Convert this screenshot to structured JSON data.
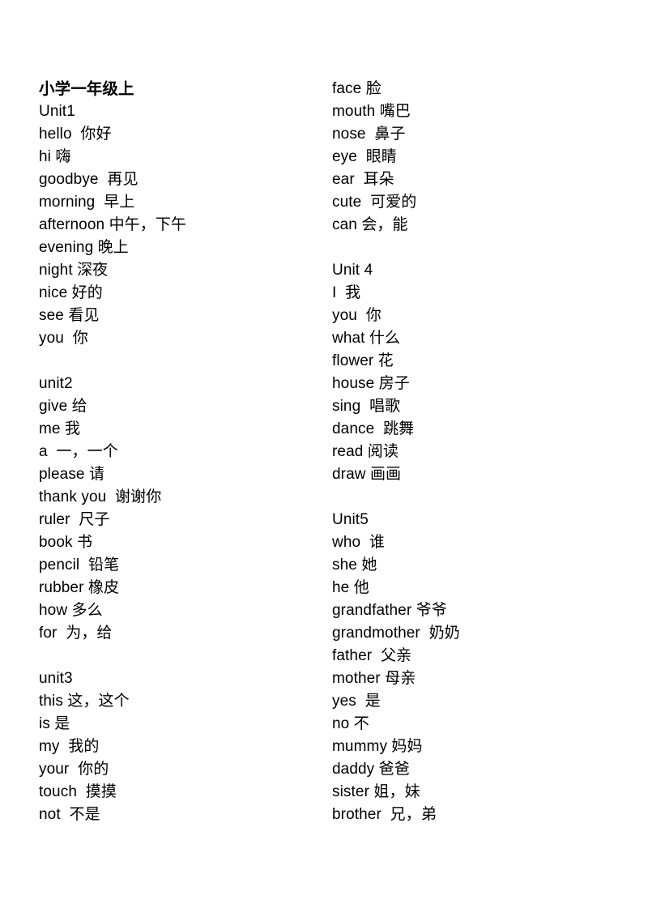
{
  "document": {
    "title": "小学一年级上",
    "columns": [
      {
        "name": "left-column",
        "lines": [
          {
            "type": "title",
            "text": "小学一年级上"
          },
          {
            "type": "unit",
            "text": "Unit1"
          },
          {
            "type": "entry",
            "text": "hello  你好"
          },
          {
            "type": "entry",
            "text": "hi 嗨"
          },
          {
            "type": "entry",
            "text": "goodbye  再见"
          },
          {
            "type": "entry",
            "text": "morning  早上"
          },
          {
            "type": "entry",
            "text": "afternoon 中午，下午"
          },
          {
            "type": "entry",
            "text": "evening 晚上"
          },
          {
            "type": "entry",
            "text": "night 深夜"
          },
          {
            "type": "entry",
            "text": "nice 好的"
          },
          {
            "type": "entry",
            "text": "see 看见"
          },
          {
            "type": "entry",
            "text": "you  你"
          },
          {
            "type": "blank",
            "text": ""
          },
          {
            "type": "unit",
            "text": "unit2"
          },
          {
            "type": "entry",
            "text": "give 给"
          },
          {
            "type": "entry",
            "text": "me 我"
          },
          {
            "type": "entry",
            "text": "a  一，一个"
          },
          {
            "type": "entry",
            "text": "please 请"
          },
          {
            "type": "entry",
            "text": "thank you  谢谢你"
          },
          {
            "type": "entry",
            "text": "ruler  尺子"
          },
          {
            "type": "entry",
            "text": "book 书"
          },
          {
            "type": "entry",
            "text": "pencil  铅笔"
          },
          {
            "type": "entry",
            "text": "rubber 橡皮"
          },
          {
            "type": "entry",
            "text": "how 多么"
          },
          {
            "type": "entry",
            "text": "for  为，给"
          },
          {
            "type": "blank",
            "text": ""
          },
          {
            "type": "unit",
            "text": "unit3"
          },
          {
            "type": "entry",
            "text": "this 这，这个"
          },
          {
            "type": "entry",
            "text": "is 是"
          },
          {
            "type": "entry",
            "text": "my  我的"
          },
          {
            "type": "entry",
            "text": "your  你的"
          },
          {
            "type": "entry",
            "text": "touch  摸摸"
          },
          {
            "type": "entry",
            "text": "not  不是"
          }
        ]
      },
      {
        "name": "right-column",
        "lines": [
          {
            "type": "entry",
            "text": "face 脸"
          },
          {
            "type": "entry",
            "text": "mouth 嘴巴"
          },
          {
            "type": "entry",
            "text": "nose  鼻子"
          },
          {
            "type": "entry",
            "text": "eye  眼睛"
          },
          {
            "type": "entry",
            "text": "ear  耳朵"
          },
          {
            "type": "entry",
            "text": "cute  可爱的"
          },
          {
            "type": "entry",
            "text": "can 会，能"
          },
          {
            "type": "blank",
            "text": ""
          },
          {
            "type": "unit",
            "text": "Unit 4"
          },
          {
            "type": "entry",
            "text": "I  我"
          },
          {
            "type": "entry",
            "text": "you  你"
          },
          {
            "type": "entry",
            "text": "what 什么"
          },
          {
            "type": "entry",
            "text": "flower 花"
          },
          {
            "type": "entry",
            "text": "house 房子"
          },
          {
            "type": "entry",
            "text": "sing  唱歌"
          },
          {
            "type": "entry",
            "text": "dance  跳舞"
          },
          {
            "type": "entry",
            "text": "read 阅读"
          },
          {
            "type": "entry",
            "text": "draw 画画"
          },
          {
            "type": "blank",
            "text": ""
          },
          {
            "type": "unit",
            "text": "Unit5"
          },
          {
            "type": "entry",
            "text": "who  谁"
          },
          {
            "type": "entry",
            "text": "she 她"
          },
          {
            "type": "entry",
            "text": "he 他"
          },
          {
            "type": "entry",
            "text": "grandfather 爷爷"
          },
          {
            "type": "entry",
            "text": "grandmother  奶奶"
          },
          {
            "type": "entry",
            "text": "father  父亲"
          },
          {
            "type": "entry",
            "text": "mother 母亲"
          },
          {
            "type": "entry",
            "text": "yes  是"
          },
          {
            "type": "entry",
            "text": "no 不"
          },
          {
            "type": "entry",
            "text": "mummy 妈妈"
          },
          {
            "type": "entry",
            "text": "daddy 爸爸"
          },
          {
            "type": "entry",
            "text": "sister 姐，妹"
          },
          {
            "type": "entry",
            "text": "brother  兄，弟"
          }
        ]
      }
    ]
  }
}
